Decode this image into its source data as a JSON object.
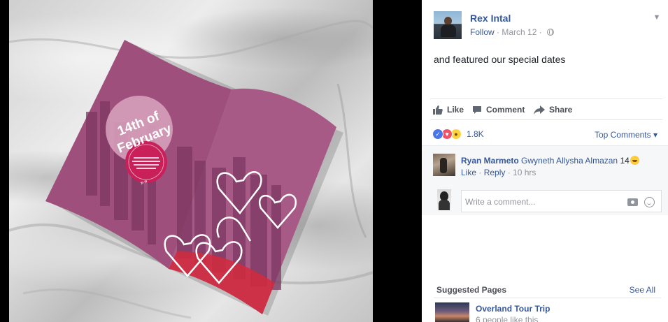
{
  "post": {
    "author": "Rex Intal",
    "follow": "Follow",
    "separator": "·",
    "date": "March 12",
    "separator2": "·",
    "caption": "and featured our special dates"
  },
  "magazine": {
    "badge_line1": "14th of",
    "badge_line2": "February",
    "colors": {
      "page": "#9e4f7c",
      "badge": "#c9205a",
      "accent_red": "#d22a3c"
    }
  },
  "actions": {
    "like": "Like",
    "comment": "Comment",
    "share": "Share"
  },
  "reactions": {
    "count": "1.8K",
    "top_comments": "Top Comments ▾"
  },
  "comment": {
    "name": "Ryan Marmeto",
    "tag": "Gwyneth Allysha Almazan",
    "text": " 14",
    "like": "Like",
    "dot": " · ",
    "reply": "Reply",
    "dot2": " · ",
    "time": "10 hrs"
  },
  "write_comment": {
    "placeholder": "Write a comment..."
  },
  "suggested": {
    "title": "Suggested Pages",
    "see_all": "See All",
    "page_name": "Overland Tour Trip",
    "page_likes": "6 people like this"
  },
  "theme": {
    "link": "#365899",
    "text": "#1d2129",
    "muted": "#90949c"
  }
}
